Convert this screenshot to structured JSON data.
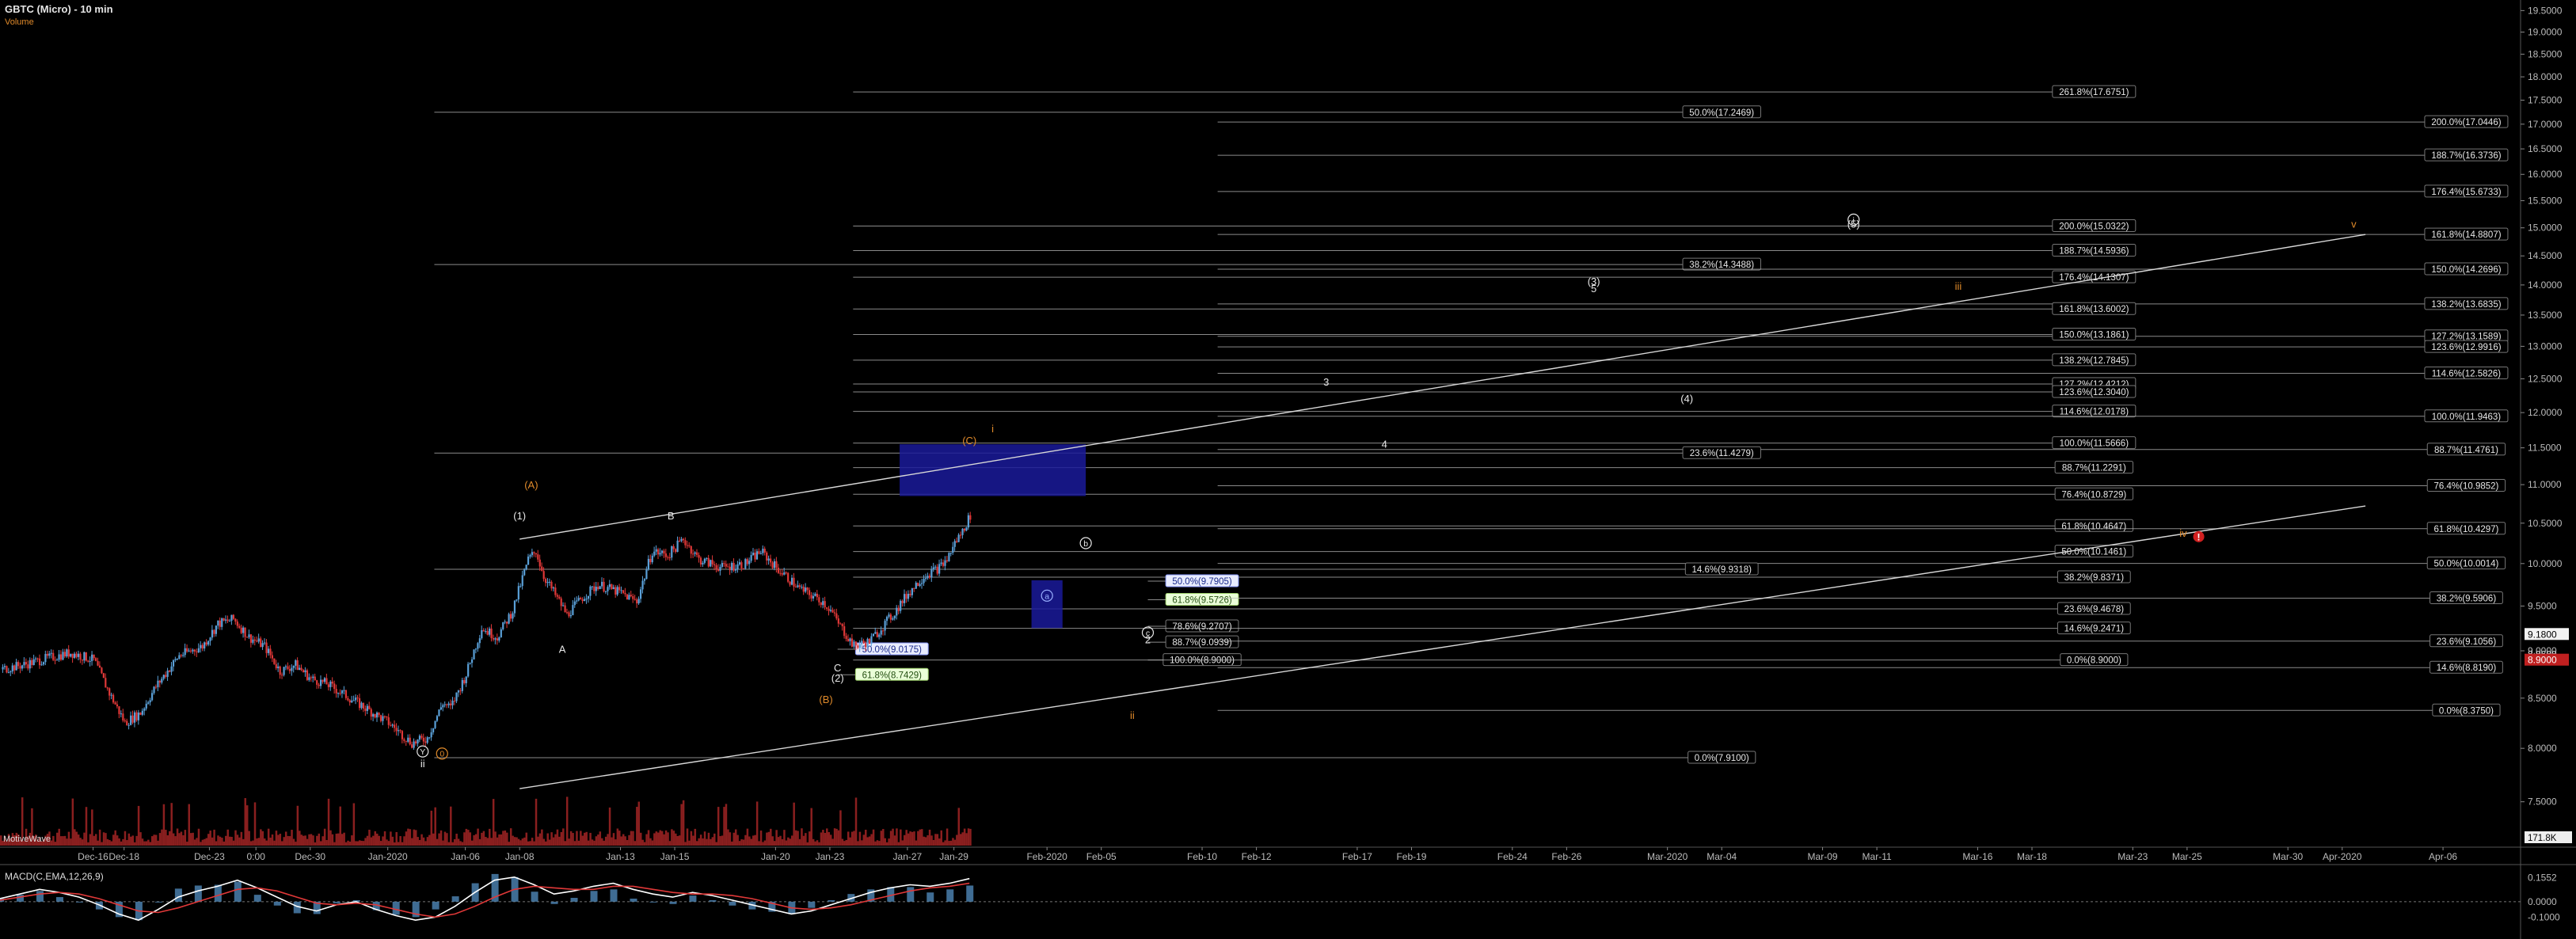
{
  "header": {
    "title": "GBTC (Micro) - 10 min",
    "volume_label": "Volume",
    "watermark": "MotiveWave",
    "macd_label": "MACD(C,EMA,12,26,9)"
  },
  "colors": {
    "background": "#000000",
    "price_up": "#5aa0d8",
    "price_down": "#e03838",
    "volume": "#8a1f1f",
    "macd_line": "#ffffff",
    "signal_line": "#e03838",
    "histogram": "#4f87b8",
    "fib_line": "#b8b8b8",
    "wave_orange": "#e08a2a",
    "zone_blue": "#1a1a9a"
  },
  "chart_data": [
    {
      "type": "candlestick",
      "title": "GBTC (Micro) - 10 min",
      "y_scale": "log",
      "ylim": [
        7.1,
        19.6
      ],
      "yticks": [
        "19.5000",
        "19.0000",
        "18.5000",
        "18.0000",
        "17.5000",
        "17.0000",
        "16.5000",
        "16.0000",
        "15.5000",
        "15.0000",
        "14.5000",
        "14.0000",
        "13.5000",
        "13.0000",
        "12.5000",
        "12.0000",
        "11.5000",
        "11.0000",
        "10.5000",
        "10.0000",
        "9.5000",
        "9.0000",
        "8.5000",
        "8.0000",
        "7.5000"
      ],
      "ytick_values": [
        19.5,
        19.0,
        18.5,
        18.0,
        17.5,
        17.0,
        16.5,
        16.0,
        15.5,
        15.0,
        14.5,
        14.0,
        13.5,
        13.0,
        12.5,
        12.0,
        11.5,
        11.0,
        10.5,
        10.0,
        9.5,
        9.0,
        8.5,
        8.0,
        7.5
      ],
      "xticks": [
        "Dec-16",
        "Dec-18",
        "Dec-23",
        "0:00",
        "Dec-30",
        "Jan-2020",
        "Jan-06",
        "Jan-08",
        "Jan-13",
        "Jan-15",
        "Jan-20",
        "Jan-23",
        "Jan-27",
        "Jan-29",
        "Feb-2020",
        "Feb-05",
        "Feb-10",
        "Feb-12",
        "Feb-17",
        "Feb-19",
        "Feb-24",
        "Feb-26",
        "Mar-2020",
        "Mar-04",
        "Mar-09",
        "Mar-11",
        "Mar-16",
        "Mar-18",
        "Mar-23",
        "Mar-25",
        "Mar-30",
        "Apr-2020",
        "Apr-06"
      ],
      "xtick_idx": [
        12,
        16,
        27,
        33,
        40,
        50,
        60,
        67,
        80,
        87,
        100,
        107,
        117,
        123,
        135,
        142,
        155,
        162,
        175,
        182,
        195,
        202,
        215,
        222,
        235,
        242,
        255,
        262,
        275,
        282,
        295,
        302,
        315
      ],
      "x_total": 325,
      "price": [
        [
          0,
          8.8
        ],
        [
          3,
          8.85
        ],
        [
          6,
          8.92
        ],
        [
          9,
          8.98
        ],
        [
          12,
          8.9
        ],
        [
          14,
          8.55
        ],
        [
          16,
          8.25
        ],
        [
          18,
          8.35
        ],
        [
          20,
          8.62
        ],
        [
          23,
          8.95
        ],
        [
          26,
          9.05
        ],
        [
          28,
          9.3
        ],
        [
          30,
          9.35
        ],
        [
          32,
          9.15
        ],
        [
          34,
          9.05
        ],
        [
          36,
          8.78
        ],
        [
          38,
          8.85
        ],
        [
          40,
          8.7
        ],
        [
          42,
          8.65
        ],
        [
          45,
          8.5
        ],
        [
          48,
          8.35
        ],
        [
          50,
          8.25
        ],
        [
          53,
          8.05
        ],
        [
          55,
          8.1
        ],
        [
          57,
          8.45
        ],
        [
          58,
          8.4
        ],
        [
          60,
          8.75
        ],
        [
          62,
          9.25
        ],
        [
          64,
          9.15
        ],
        [
          66,
          9.45
        ],
        [
          68,
          10.05
        ],
        [
          69,
          10.15
        ],
        [
          70,
          9.85
        ],
        [
          72,
          9.55
        ],
        [
          73,
          9.4
        ],
        [
          75,
          9.6
        ],
        [
          77,
          9.75
        ],
        [
          80,
          9.65
        ],
        [
          82,
          9.55
        ],
        [
          84,
          10.15
        ],
        [
          86,
          10.1
        ],
        [
          88,
          10.3
        ],
        [
          90,
          10.05
        ],
        [
          93,
          9.95
        ],
        [
          96,
          10.0
        ],
        [
          98,
          10.15
        ],
        [
          100,
          9.95
        ],
        [
          103,
          9.7
        ],
        [
          106,
          9.55
        ],
        [
          107,
          9.45
        ],
        [
          108,
          9.3
        ],
        [
          110,
          9.05
        ],
        [
          112,
          9.1
        ],
        [
          114,
          9.3
        ],
        [
          115,
          9.4
        ],
        [
          117,
          9.65
        ],
        [
          119,
          9.85
        ],
        [
          121,
          9.95
        ],
        [
          122,
          10.05
        ],
        [
          123,
          10.25
        ],
        [
          124,
          10.4
        ],
        [
          125,
          10.6
        ]
      ],
      "price_visible_end_idx": 125,
      "series": [
        {
          "role": "price",
          "values_key": "price"
        }
      ],
      "fib_levels": [
        {
          "label": "261.8%(17.6751)",
          "value": 17.6751,
          "x0": 110,
          "x1": 270
        },
        {
          "label": "50.0%(17.2469)",
          "value": 17.2469,
          "x0": 56,
          "x1": 222
        },
        {
          "label": "200.0%(17.0446)",
          "value": 17.0446,
          "x0": 157,
          "x1": 318
        },
        {
          "label": "188.7%(16.3736)",
          "value": 16.3736,
          "x0": 157,
          "x1": 318
        },
        {
          "label": "176.4%(15.6733)",
          "value": 15.6733,
          "x0": 157,
          "x1": 318
        },
        {
          "label": "200.0%(15.0322)",
          "value": 15.0322,
          "x0": 110,
          "x1": 270
        },
        {
          "label": "161.8%(14.8807)",
          "value": 14.8807,
          "x0": 157,
          "x1": 318
        },
        {
          "label": "188.7%(14.5936)",
          "value": 14.5936,
          "x0": 110,
          "x1": 270
        },
        {
          "label": "38.2%(14.3488)",
          "value": 14.3488,
          "x0": 56,
          "x1": 222
        },
        {
          "label": "150.0%(14.2696)",
          "value": 14.2696,
          "x0": 157,
          "x1": 318
        },
        {
          "label": "176.4%(14.1307)",
          "value": 14.1307,
          "x0": 110,
          "x1": 270
        },
        {
          "label": "138.2%(13.6835)",
          "value": 13.6835,
          "x0": 157,
          "x1": 318
        },
        {
          "label": "161.8%(13.6002)",
          "value": 13.6002,
          "x0": 110,
          "x1": 270
        },
        {
          "label": "127.2%(13.1589)",
          "value": 13.1589,
          "x0": 157,
          "x1": 318
        },
        {
          "label": "150.0%(13.1861)",
          "value": 13.1861,
          "x0": 110,
          "x1": 270
        },
        {
          "label": "123.6%(12.9916)",
          "value": 12.9916,
          "x0": 157,
          "x1": 318
        },
        {
          "label": "138.2%(12.7845)",
          "value": 12.7845,
          "x0": 110,
          "x1": 270
        },
        {
          "label": "114.6%(12.5826)",
          "value": 12.5826,
          "x0": 157,
          "x1": 318
        },
        {
          "label": "127.2%(12.4212)",
          "value": 12.4212,
          "x0": 110,
          "x1": 270
        },
        {
          "label": "123.6%(12.3040)",
          "value": 12.304,
          "x0": 110,
          "x1": 270
        },
        {
          "label": "114.6%(12.0178)",
          "value": 12.0178,
          "x0": 110,
          "x1": 270
        },
        {
          "label": "100.0%(11.9463)",
          "value": 11.9463,
          "x0": 157,
          "x1": 318
        },
        {
          "label": "100.0%(11.5666)",
          "value": 11.5666,
          "x0": 110,
          "x1": 270
        },
        {
          "label": "88.7%(11.4761)",
          "value": 11.4761,
          "x0": 157,
          "x1": 318
        },
        {
          "label": "23.6%(11.4279)",
          "value": 11.4279,
          "x0": 56,
          "x1": 222
        },
        {
          "label": "88.7%(11.2291)",
          "value": 11.2291,
          "x0": 110,
          "x1": 270
        },
        {
          "label": "76.4%(10.9852)",
          "value": 10.9852,
          "x0": 157,
          "x1": 318
        },
        {
          "label": "76.4%(10.8729)",
          "value": 10.8729,
          "x0": 110,
          "x1": 270
        },
        {
          "label": "61.8%(10.4647)",
          "value": 10.4647,
          "x0": 110,
          "x1": 270
        },
        {
          "label": "61.8%(10.4297)",
          "value": 10.4297,
          "x0": 157,
          "x1": 318
        },
        {
          "label": "50.0%(10.1461)",
          "value": 10.1461,
          "x0": 110,
          "x1": 270
        },
        {
          "label": "50.0%(10.0014)",
          "value": 10.0014,
          "x0": 157,
          "x1": 318
        },
        {
          "label": "14.6%(9.9318)",
          "value": 9.9318,
          "x0": 56,
          "x1": 222
        },
        {
          "label": "38.2%(9.8371)",
          "value": 9.8371,
          "x0": 110,
          "x1": 270
        },
        {
          "label": "50.0%(9.7905)",
          "value": 9.7905,
          "x0": 148,
          "x1": 155
        },
        {
          "label": "61.8%(9.5726)",
          "value": 9.5726,
          "x0": 148,
          "x1": 155
        },
        {
          "label": "38.2%(9.5906)",
          "value": 9.5906,
          "x0": 157,
          "x1": 318
        },
        {
          "label": "23.6%(9.4678)",
          "value": 9.4678,
          "x0": 110,
          "x1": 270
        },
        {
          "label": "78.6%(9.2707)",
          "value": 9.2707,
          "x0": 148,
          "x1": 155
        },
        {
          "label": "14.6%(9.2471)",
          "value": 9.2471,
          "x0": 110,
          "x1": 270
        },
        {
          "label": "88.7%(9.0939)",
          "value": 9.0939,
          "x0": 148,
          "x1": 155
        },
        {
          "label": "23.6%(9.1056)",
          "value": 9.1056,
          "x0": 157,
          "x1": 318
        },
        {
          "label": "50.0%(9.0175)",
          "value": 9.0175,
          "x0": 108,
          "x1": 115
        },
        {
          "label": "100.0%(8.9000)",
          "value": 8.9,
          "x0": 148,
          "x1": 155
        },
        {
          "label": "0.0%(8.9000)",
          "value": 8.9,
          "x0": 110,
          "x1": 270
        },
        {
          "label": "14.6%(8.8190)",
          "value": 8.819,
          "x0": 157,
          "x1": 318
        },
        {
          "label": "61.8%(8.7429)",
          "value": 8.7429,
          "x0": 108,
          "x1": 115
        },
        {
          "label": "0.0%(8.3750)",
          "value": 8.375,
          "x0": 157,
          "x1": 318
        },
        {
          "label": "0.0%(7.9100)",
          "value": 7.91,
          "x0": 56,
          "x1": 222
        }
      ],
      "price_markers": [
        {
          "label": "9.1800",
          "value": 9.18,
          "style": "white"
        },
        {
          "label": "8.9600",
          "value": 8.96,
          "style": "plain"
        },
        {
          "label": "8.9000",
          "value": 8.9,
          "style": "red"
        }
      ],
      "trendlines": [
        {
          "x0": 67,
          "y0": 10.3,
          "x1": 305,
          "y1": 14.88
        },
        {
          "x0": 67,
          "y0": 7.62,
          "x1": 305,
          "y1": 10.72
        }
      ],
      "zones": [
        {
          "x0": 116,
          "x1": 140,
          "y0": 10.85,
          "y1": 11.55
        },
        {
          "x0": 133,
          "x1": 137,
          "y0": 9.25,
          "y1": 9.8
        }
      ],
      "wave_labels": [
        {
          "text": "(A)",
          "x": 68.5,
          "y": 10.95,
          "color": "orange"
        },
        {
          "text": "(1)",
          "x": 67,
          "y": 10.55,
          "color": "white"
        },
        {
          "text": "B",
          "x": 86.5,
          "y": 10.55,
          "color": "white"
        },
        {
          "text": "A",
          "x": 72.5,
          "y": 8.98,
          "color": "white"
        },
        {
          "text": "i",
          "x": 128,
          "y": 11.72,
          "color": "orange"
        },
        {
          "text": "(C)",
          "x": 125,
          "y": 11.55,
          "color": "orange"
        },
        {
          "text": "C",
          "x": 108,
          "y": 8.78,
          "color": "white"
        },
        {
          "text": "(2)",
          "x": 108,
          "y": 8.67,
          "color": "white"
        },
        {
          "text": "(B)",
          "x": 106.5,
          "y": 8.45,
          "color": "orange"
        },
        {
          "text": "ii",
          "x": 146,
          "y": 8.29,
          "color": "orange"
        },
        {
          "text": "ii",
          "x": 54.5,
          "y": 7.82,
          "color": "white"
        },
        {
          "text": "3",
          "x": 171,
          "y": 12.4,
          "color": "white"
        },
        {
          "text": "4",
          "x": 178.5,
          "y": 11.5,
          "color": "white"
        },
        {
          "text": "(3)",
          "x": 205.5,
          "y": 14.0,
          "color": "white"
        },
        {
          "text": "5",
          "x": 205.5,
          "y": 13.88,
          "color": "white"
        },
        {
          "text": "(4)",
          "x": 217.5,
          "y": 12.15,
          "color": "white"
        },
        {
          "text": "(5)",
          "x": 239,
          "y": 15.0,
          "color": "white"
        },
        {
          "text": "iii",
          "x": 252.5,
          "y": 13.92,
          "color": "orange"
        },
        {
          "text": "v",
          "x": 303.5,
          "y": 15.0,
          "color": "orange"
        },
        {
          "text": "iv",
          "x": 281.5,
          "y": 10.33,
          "color": "orange"
        },
        {
          "text": "2",
          "x": 148,
          "y": 9.08,
          "color": "white"
        }
      ],
      "circle_labels": [
        {
          "text": "Y",
          "x": 54.5,
          "y": 7.97,
          "color": "white"
        },
        {
          "text": "0",
          "x": 57,
          "y": 7.95,
          "color": "orange"
        },
        {
          "text": "i",
          "x": 239,
          "y": 15.15,
          "color": "white"
        },
        {
          "text": "b",
          "x": 140,
          "y": 10.25,
          "color": "white"
        },
        {
          "text": "a",
          "x": 135,
          "y": 9.62,
          "color": "blue"
        },
        {
          "text": "c",
          "x": 148,
          "y": 9.2,
          "color": "white"
        }
      ],
      "alert_marker": {
        "x": 283.5,
        "y": 10.33,
        "text": "!"
      }
    },
    {
      "type": "bar",
      "title": "Volume",
      "volume_marker": "171.8K",
      "note": "volume bars under price"
    },
    {
      "type": "line",
      "title": "MACD(C,EMA,12,26,9)",
      "yticks": [
        "0.1552",
        "0.0000",
        "-0.1000"
      ],
      "ytick_values": [
        0.1552,
        0.0,
        -0.1
      ],
      "ylim": [
        -0.16,
        0.2
      ],
      "series": [
        {
          "name": "MACD",
          "values": [
            0.02,
            0.05,
            0.08,
            0.06,
            0.03,
            -0.02,
            -0.08,
            -0.12,
            -0.05,
            0.03,
            0.07,
            0.1,
            0.14,
            0.09,
            0.03,
            -0.03,
            -0.06,
            -0.02,
            0.0,
            -0.05,
            -0.09,
            -0.12,
            -0.1,
            -0.03,
            0.06,
            0.14,
            0.16,
            0.11,
            0.05,
            0.07,
            0.1,
            0.12,
            0.08,
            0.05,
            0.03,
            0.06,
            0.04,
            0.01,
            -0.02,
            -0.05,
            -0.08,
            -0.06,
            -0.02,
            0.02,
            0.06,
            0.09,
            0.11,
            0.1,
            0.12,
            0.15
          ]
        },
        {
          "name": "Signal",
          "values": [
            0.01,
            0.03,
            0.05,
            0.06,
            0.05,
            0.02,
            -0.02,
            -0.06,
            -0.07,
            -0.04,
            0.0,
            0.04,
            0.08,
            0.09,
            0.07,
            0.03,
            -0.01,
            -0.02,
            -0.01,
            -0.02,
            -0.05,
            -0.08,
            -0.1,
            -0.08,
            -0.03,
            0.03,
            0.08,
            0.1,
            0.09,
            0.08,
            0.08,
            0.1,
            0.1,
            0.08,
            0.06,
            0.05,
            0.05,
            0.04,
            0.02,
            -0.01,
            -0.04,
            -0.05,
            -0.04,
            -0.02,
            0.01,
            0.04,
            0.07,
            0.09,
            0.1,
            0.12
          ]
        }
      ]
    }
  ]
}
